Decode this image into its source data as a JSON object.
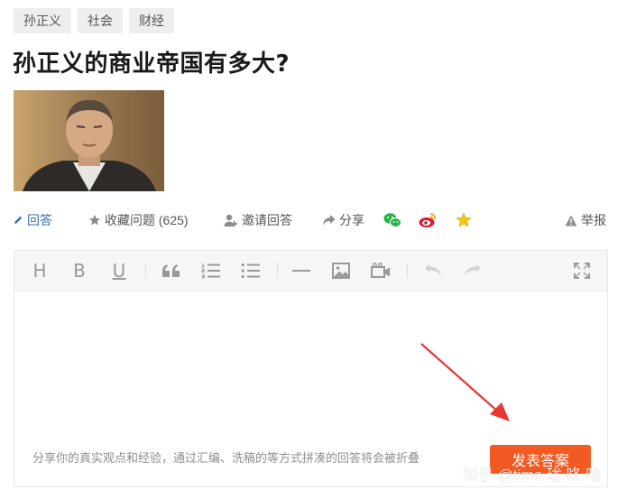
{
  "tags": [
    "孙正义",
    "社会",
    "财经"
  ],
  "question": {
    "title": "孙正义的商业帝国有多大?"
  },
  "actions": {
    "answer": "回答",
    "collect": "收藏问题 (625)",
    "invite": "邀请回答",
    "share": "分享",
    "report": "举报"
  },
  "editor": {
    "toolbar": [
      "heading-icon",
      "bold-icon",
      "underline-icon",
      "quote-icon",
      "ordered-list-icon",
      "unordered-list-icon",
      "divider-icon",
      "image-icon",
      "video-icon",
      "undo-icon",
      "redo-icon",
      "fullscreen-icon"
    ],
    "hint": "分享你的真实观点和经验，通过汇编、洗稿的等方式拼凑的回答将会被折叠",
    "submit_label": "发表答案"
  },
  "watermark": "知乎 @time 珑 咚 哈",
  "colors": {
    "submit": "#f25a24",
    "link": "#3a6fb0",
    "arrow": "#e53935",
    "star": "#f5c518",
    "wechat": "#2bb24c",
    "weibo": "#e6162d"
  }
}
